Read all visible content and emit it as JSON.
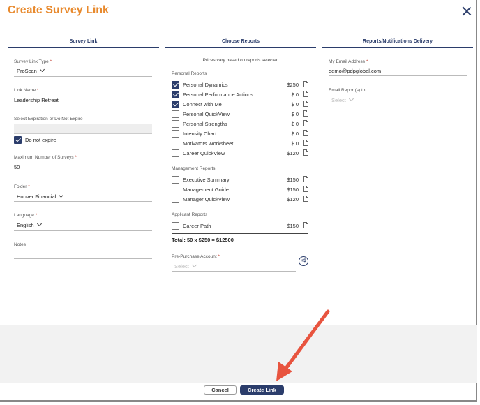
{
  "dialog": {
    "title": "Create Survey Link"
  },
  "columns": {
    "survey_link": "Survey Link",
    "choose_reports": "Choose Reports",
    "delivery": "Reports/Notifications Delivery"
  },
  "survey_link": {
    "link_type": {
      "label": "Survey Link Type",
      "required_mark": "*",
      "value": "ProScan"
    },
    "link_name": {
      "label": "Link Name",
      "required_mark": "*",
      "value": "Leadership Retreat"
    },
    "expiration": {
      "label": "Select Expiration or Do Not Expire",
      "value": ""
    },
    "do_not_expire": {
      "label": "Do not expire",
      "checked": true
    },
    "max_surveys": {
      "label": "Maximum Number of Surveys",
      "required_mark": "*",
      "value": "50"
    },
    "folder": {
      "label": "Folder",
      "required_mark": "*",
      "value": "Hoover Financial"
    },
    "language": {
      "label": "Language",
      "required_mark": "*",
      "value": "English"
    },
    "notes": {
      "label": "Notes",
      "value": ""
    }
  },
  "reports": {
    "note": "Prices vary based on reports selected",
    "personal": {
      "label": "Personal Reports",
      "items": [
        {
          "name": "Personal Dynamics",
          "price": "$250",
          "checked": true
        },
        {
          "name": "Personal Performance Actions",
          "price": "$ 0",
          "checked": true
        },
        {
          "name": "Connect with Me",
          "price": "$ 0",
          "checked": true
        },
        {
          "name": "Personal QuickView",
          "price": "$ 0",
          "checked": false
        },
        {
          "name": "Personal Strengths",
          "price": "$ 0",
          "checked": false
        },
        {
          "name": "Intensity Chart",
          "price": "$ 0",
          "checked": false
        },
        {
          "name": "Motivators Worksheet",
          "price": "$ 0",
          "checked": false
        },
        {
          "name": "Career QuickView",
          "price": "$120",
          "checked": false
        }
      ]
    },
    "management": {
      "label": "Management Reports",
      "items": [
        {
          "name": "Executive Summary",
          "price": "$150",
          "checked": false
        },
        {
          "name": "Management Guide",
          "price": "$150",
          "checked": false
        },
        {
          "name": "Manager QuickView",
          "price": "$120",
          "checked": false
        }
      ]
    },
    "applicant": {
      "label": "Applicant Reports",
      "items": [
        {
          "name": "Career Path",
          "price": "$150",
          "checked": false
        }
      ]
    },
    "total": "Total: 50 x $250 = $12500",
    "pre_purchase": {
      "label": "Pre-Purchase Account",
      "required_mark": "*",
      "placeholder": "Select"
    },
    "add_funds_icon": "+$"
  },
  "delivery": {
    "my_email": {
      "label": "My Email Address",
      "required_mark": "*",
      "value": "demo@pdpglobal.com"
    },
    "email_reports_to": {
      "label": "Email Report(s) to",
      "placeholder": "Select"
    }
  },
  "footer": {
    "cancel_label": "Cancel",
    "create_label": "Create Link"
  },
  "colors": {
    "title_orange": "#e88a2e",
    "navy": "#2b3d6b",
    "annotation_arrow": "#e8543f"
  }
}
